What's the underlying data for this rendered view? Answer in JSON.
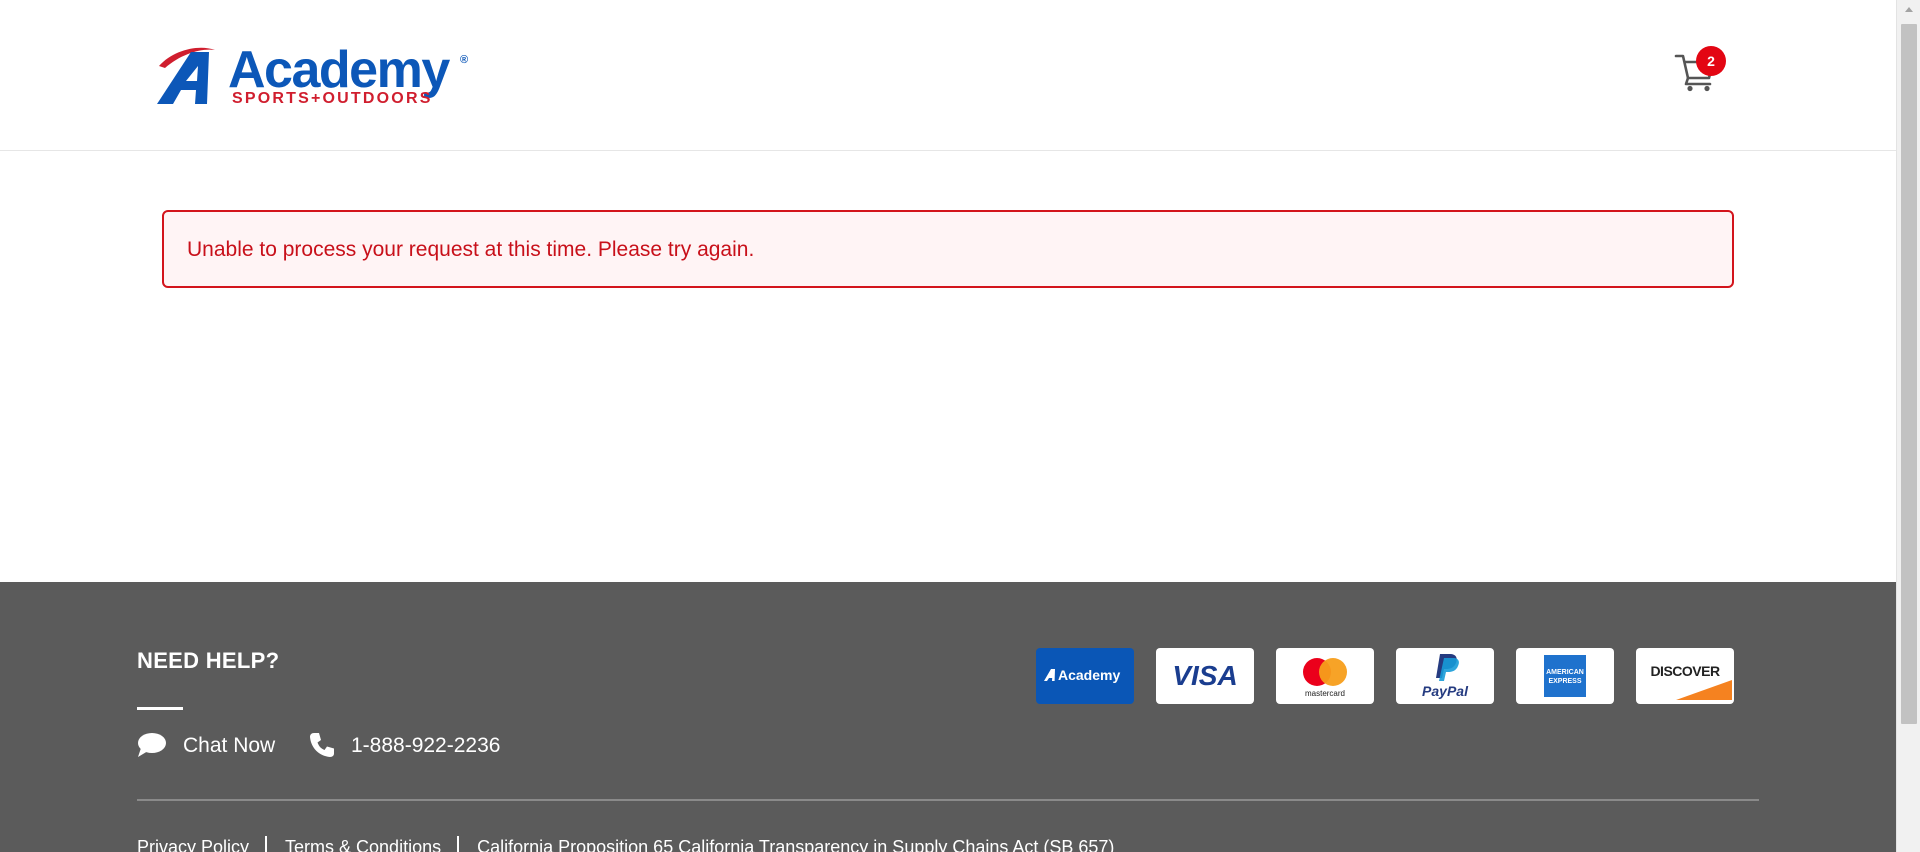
{
  "header": {
    "logo": {
      "brand_name": "Academy",
      "registered_mark": "®",
      "tagline": "SPORTS+OUTDOORS",
      "colors": {
        "blue": "#0c57b8",
        "red": "#d01e2e"
      }
    },
    "cart": {
      "icon": "shopping-cart-icon",
      "count": "2",
      "badge_color": "#e30613"
    }
  },
  "error_banner": {
    "message": "Unable to process your request at this time. Please try again.",
    "colors": {
      "border": "#d3141c",
      "background": "#fff4f5",
      "text": "#c8101a"
    }
  },
  "footer": {
    "background": "#5b5b5b",
    "help": {
      "title": "NEED HELP?",
      "chat_label": "Chat Now",
      "chat_icon": "chat-bubble-icon",
      "phone_number": "1-888-922-2236",
      "phone_icon": "phone-icon"
    },
    "payment_methods": [
      {
        "name": "Academy",
        "icon": "academy-card-logo"
      },
      {
        "name": "VISA",
        "icon": "visa-logo"
      },
      {
        "name": "mastercard",
        "icon": "mastercard-logo"
      },
      {
        "name": "PayPal",
        "icon": "paypal-logo"
      },
      {
        "name": "AMERICAN EXPRESS",
        "icon": "amex-logo"
      },
      {
        "name": "DISCOVER",
        "icon": "discover-logo"
      }
    ],
    "legal_links": [
      "Privacy Policy",
      "Terms & Conditions",
      "California Proposition 65 California Transparency in Supply Chains Act (SB 657)"
    ]
  }
}
